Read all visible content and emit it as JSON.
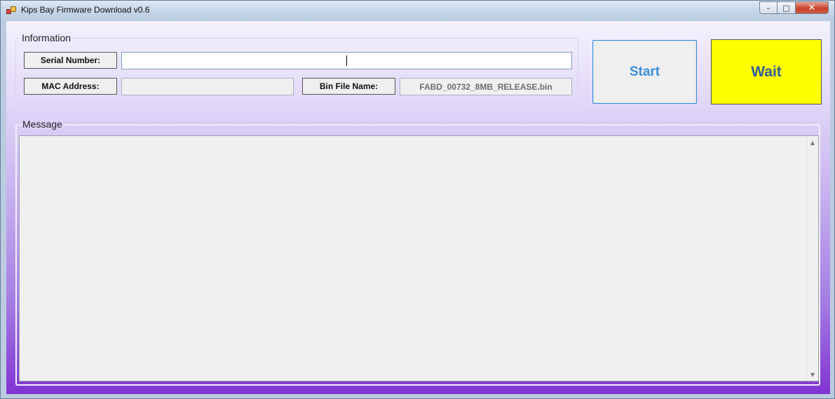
{
  "window": {
    "title": "Kips Bay Firmware Download v0.6",
    "controls": {
      "minimize": "–",
      "maximize": "□",
      "close": "✕"
    }
  },
  "information": {
    "group_title": "Information",
    "serial_label": "Serial Number:",
    "serial_value": "",
    "mac_label": "MAC Address:",
    "mac_value": "",
    "bin_label": "Bin File Name:",
    "bin_value": "FABD_00732_8MB_RELEASE.bin"
  },
  "actions": {
    "start_label": "Start",
    "status_label": "Wait",
    "status_color": "#ffff00"
  },
  "message": {
    "group_title": "Message",
    "content": "",
    "scroll_up": "▲",
    "scroll_down": "▼"
  }
}
